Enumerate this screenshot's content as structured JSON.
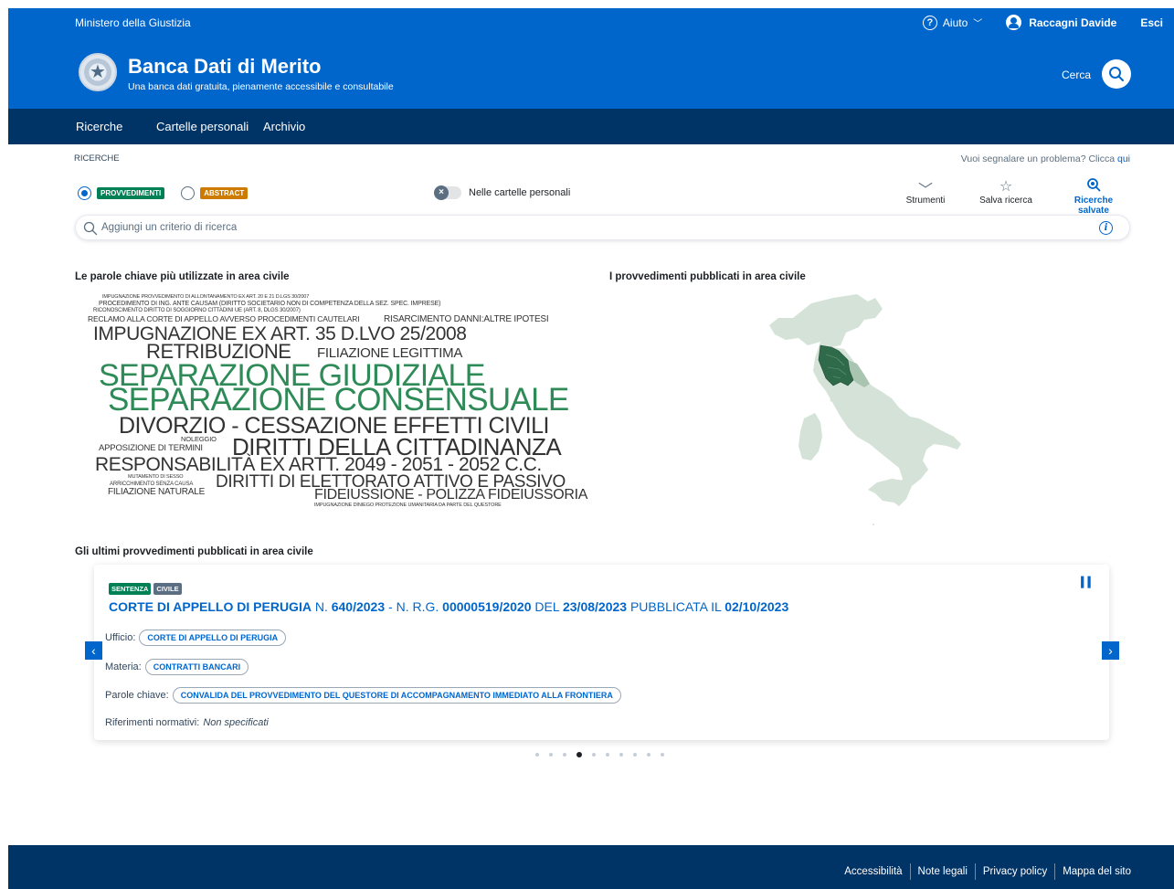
{
  "slim_header": {
    "organization": "Ministero della Giustizia",
    "help_label": "Aiuto",
    "user_name": "Raccagni Davide",
    "logout_label": "Esci"
  },
  "header": {
    "title": "Banca Dati di Merito",
    "subtitle": "Una banca dati gratuita, pienamente accessibile e consultabile",
    "search_label": "Cerca"
  },
  "nav": {
    "items": [
      {
        "label": "Ricerche",
        "active": true
      },
      {
        "label": "Cartelle personali",
        "active": false
      },
      {
        "label": "Archivio",
        "active": false
      }
    ]
  },
  "search": {
    "breadcrumb": "RICERCHE",
    "report_text": "Vuoi segnalare un problema? Clicca",
    "report_link": "qui",
    "radio_provvedimenti": "PROVVEDIMENTI",
    "radio_abstract": "ABSTRACT",
    "radio_selected": "PROVVEDIMENTI",
    "toggle_label": "Nelle cartelle personali",
    "toggle_on": false,
    "tools": {
      "strumenti": "Strumenti",
      "salva": "Salva ricerca",
      "salvate": "Ricerche salvate"
    },
    "placeholder": "Aggiungi un criterio di ricerca"
  },
  "sections": {
    "keywords_title": "Le parole chiave più utilizzate in area civile",
    "map_title": "I provvedimenti pubblicati  in area civile",
    "latest_title": "Gli ultimi provvedimenti pubblicati in area civile"
  },
  "word_cloud": {
    "words": [
      {
        "text": "IMPUGNAZIONE PROVVEDIMENTO DI ALLONTANAMENTO EX ART. 20 E 21 D.LGS 30/2007",
        "color": "#333333"
      },
      {
        "text": "PROCEDIMENTO DI ING. ANTE CAUSAM (DIRITTO SOCIETARIO NON DI COMPETENZA DELLA SEZ. SPEC. IMPRESE)",
        "color": "#333333"
      },
      {
        "text": "RICONOSCIMENTO DIRITTO DI SOGGIORNO CITTADINI UE (ART. 8, DLGS 30/2007)",
        "color": "#333333"
      },
      {
        "text": "RECLAMO ALLA CORTE DI APPELLO AVVERSO PROCEDIMENTI CAUTELARI",
        "color": "#333333"
      },
      {
        "text": "RISARCIMENTO DANNI:ALTRE IPOTESI",
        "color": "#333333"
      },
      {
        "text": "IMPUGNAZIONE EX ART. 35 D.LVO 25/2008",
        "color": "#333333"
      },
      {
        "text": "RETRIBUZIONE",
        "color": "#333333"
      },
      {
        "text": "FILIAZIONE LEGITTIMA",
        "color": "#333333"
      },
      {
        "text": "SEPARAZIONE GIUDIZIALE",
        "color": "#2e8b57"
      },
      {
        "text": "SEPARAZIONE CONSENSUALE",
        "color": "#2e8b57"
      },
      {
        "text": "DIVORZIO - CESSAZIONE EFFETTI CIVILI",
        "color": "#333333"
      },
      {
        "text": "NOLEGGIO",
        "color": "#333333"
      },
      {
        "text": "APPOSIZIONE DI TERMINI",
        "color": "#333333"
      },
      {
        "text": "DIRITTI DELLA CITTADINANZA",
        "color": "#333333"
      },
      {
        "text": "RESPONSABILITÀ EX ARTT. 2049 - 2051 - 2052 C.C.",
        "color": "#333333"
      },
      {
        "text": "MUTAMENTO DI SESSO",
        "color": "#333333"
      },
      {
        "text": "ARRICCHIMENTO SENZA CAUSA",
        "color": "#333333"
      },
      {
        "text": "FILIAZIONE NATURALE",
        "color": "#333333"
      },
      {
        "text": "DIRITTI DI ELETTORATO ATTIVO E PASSIVO",
        "color": "#333333"
      },
      {
        "text": "FIDEIUSSIONE - POLIZZA FIDEIUSSORIA",
        "color": "#333333"
      },
      {
        "text": "IMPUGNAZIONE DINIEGO PROTEZIONE UMANITARIA DA PARTE DEL QUESTORE",
        "color": "#333333"
      }
    ]
  },
  "map": {
    "highlighted_region": "Toscana",
    "colors": {
      "base": "#d4e2d8",
      "highlight": "#2f6b4a",
      "secondary": "#a9c4b0"
    }
  },
  "latest": {
    "tag_type": "SENTENZA",
    "tag_area": "CIVILE",
    "court": "CORTE DI APPELLO DI PERUGIA",
    "n_label": "N.",
    "number": "640/2023",
    "rg_label": "- N. R.G.",
    "rg_number": "00000519/2020",
    "del_label": "DEL",
    "date": "23/08/2023",
    "pub_label": "PUBBLICATA IL",
    "pub_date": "02/10/2023",
    "ufficio_label": "Ufficio:",
    "ufficio_value": "CORTE DI APPELLO DI PERUGIA",
    "materia_label": "Materia:",
    "materia_value": "CONTRATTI BANCARI",
    "parole_label": "Parole chiave:",
    "parole_value": "CONVALIDA DEL PROVVEDIMENTO DEL QUESTORE DI ACCOMPAGNAMENTO IMMEDIATO ALLA FRONTIERA",
    "riferimenti_label": "Riferimenti normativi:",
    "riferimenti_value": "Non specificati",
    "total_slides": 10,
    "active_slide": 4
  },
  "footer": {
    "links": [
      "Accessibilità",
      "Note legali",
      "Privacy policy",
      "Mappa del sito"
    ]
  },
  "colors": {
    "primary": "#0066cc",
    "dark": "#003366",
    "green": "#008055",
    "orange": "#cc7a00"
  }
}
